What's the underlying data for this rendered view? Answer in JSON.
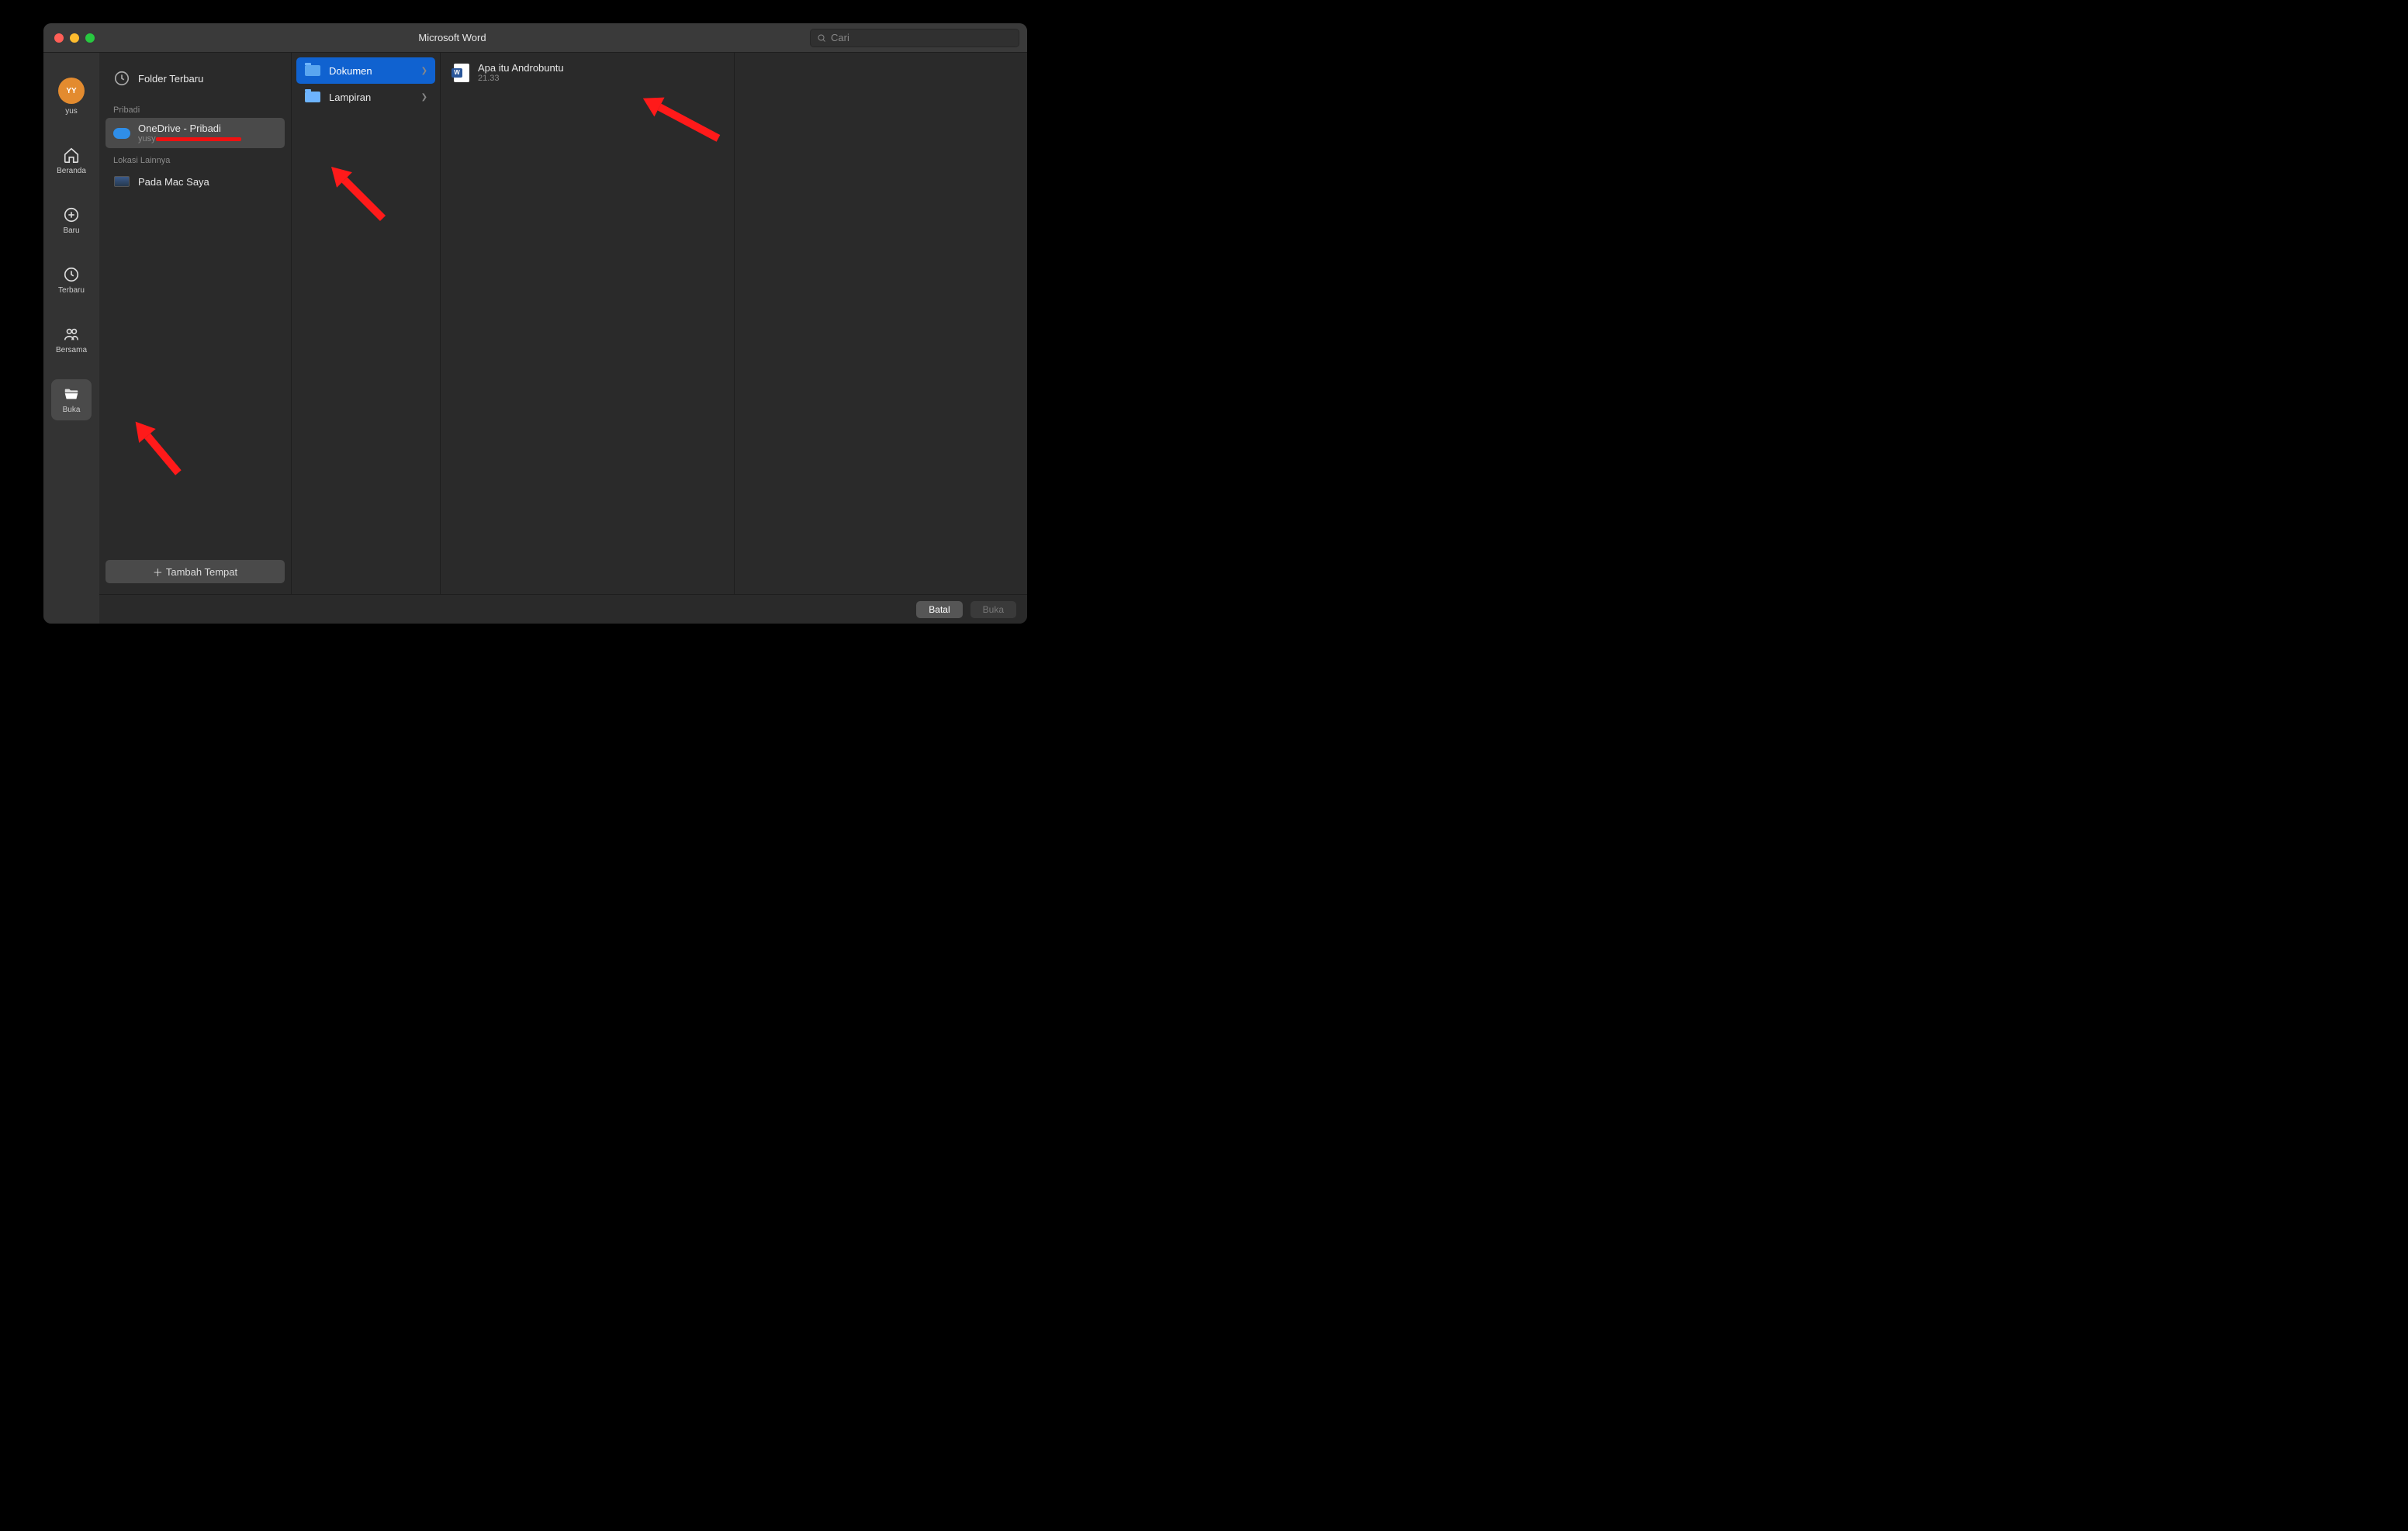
{
  "window": {
    "title": "Microsoft Word"
  },
  "search": {
    "placeholder": "Cari"
  },
  "rail": {
    "avatar_initials": "YY",
    "items": [
      {
        "label": "yus"
      },
      {
        "label": "Beranda"
      },
      {
        "label": "Baru"
      },
      {
        "label": "Terbaru"
      },
      {
        "label": "Bersama"
      },
      {
        "label": "Buka"
      }
    ]
  },
  "locations": {
    "recent_label": "Folder Terbaru",
    "section_personal": "Pribadi",
    "onedrive": {
      "label": "OneDrive - Pribadi",
      "sub_prefix": "yusy"
    },
    "section_other": "Lokasi Lainnya",
    "onmac": "Pada Mac Saya",
    "add_place": "Tambah Tempat"
  },
  "folders": [
    {
      "label": "Dokumen",
      "selected": true
    },
    {
      "label": "Lampiran",
      "selected": false
    }
  ],
  "files": [
    {
      "label": "Apa itu Androbuntu",
      "time": "21.33"
    }
  ],
  "footer": {
    "cancel": "Batal",
    "open": "Buka"
  }
}
